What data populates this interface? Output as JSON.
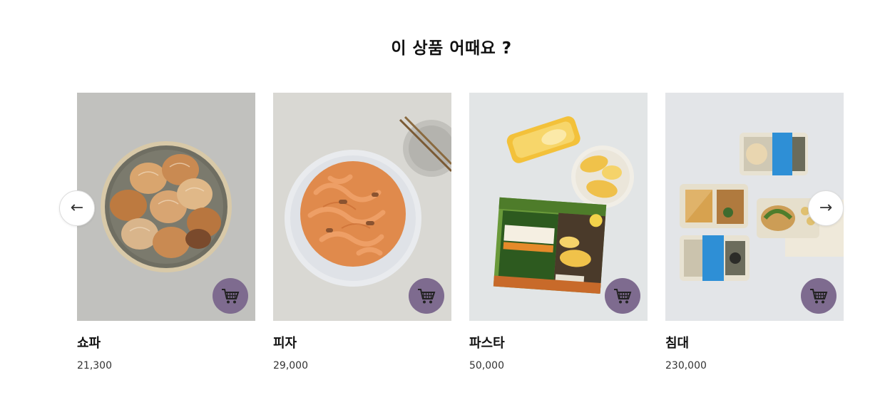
{
  "section": {
    "title": "이 상품 어때요 ?"
  },
  "navigation": {
    "prev_icon": "←",
    "next_icon": "→"
  },
  "products": [
    {
      "name": "쇼파",
      "price": "21,300",
      "image_icon": "dumplings-plate-photo"
    },
    {
      "name": "피자",
      "price": "29,000",
      "image_icon": "tteokbokki-plate-photo"
    },
    {
      "name": "파스타",
      "price": "50,000",
      "image_icon": "corn-bread-package-photo"
    },
    {
      "name": "침대",
      "price": "230,000",
      "image_icon": "lunch-boxes-photo"
    }
  ],
  "colors": {
    "cart_button": "#7e6b8f",
    "title": "#111111",
    "price": "#333333"
  }
}
